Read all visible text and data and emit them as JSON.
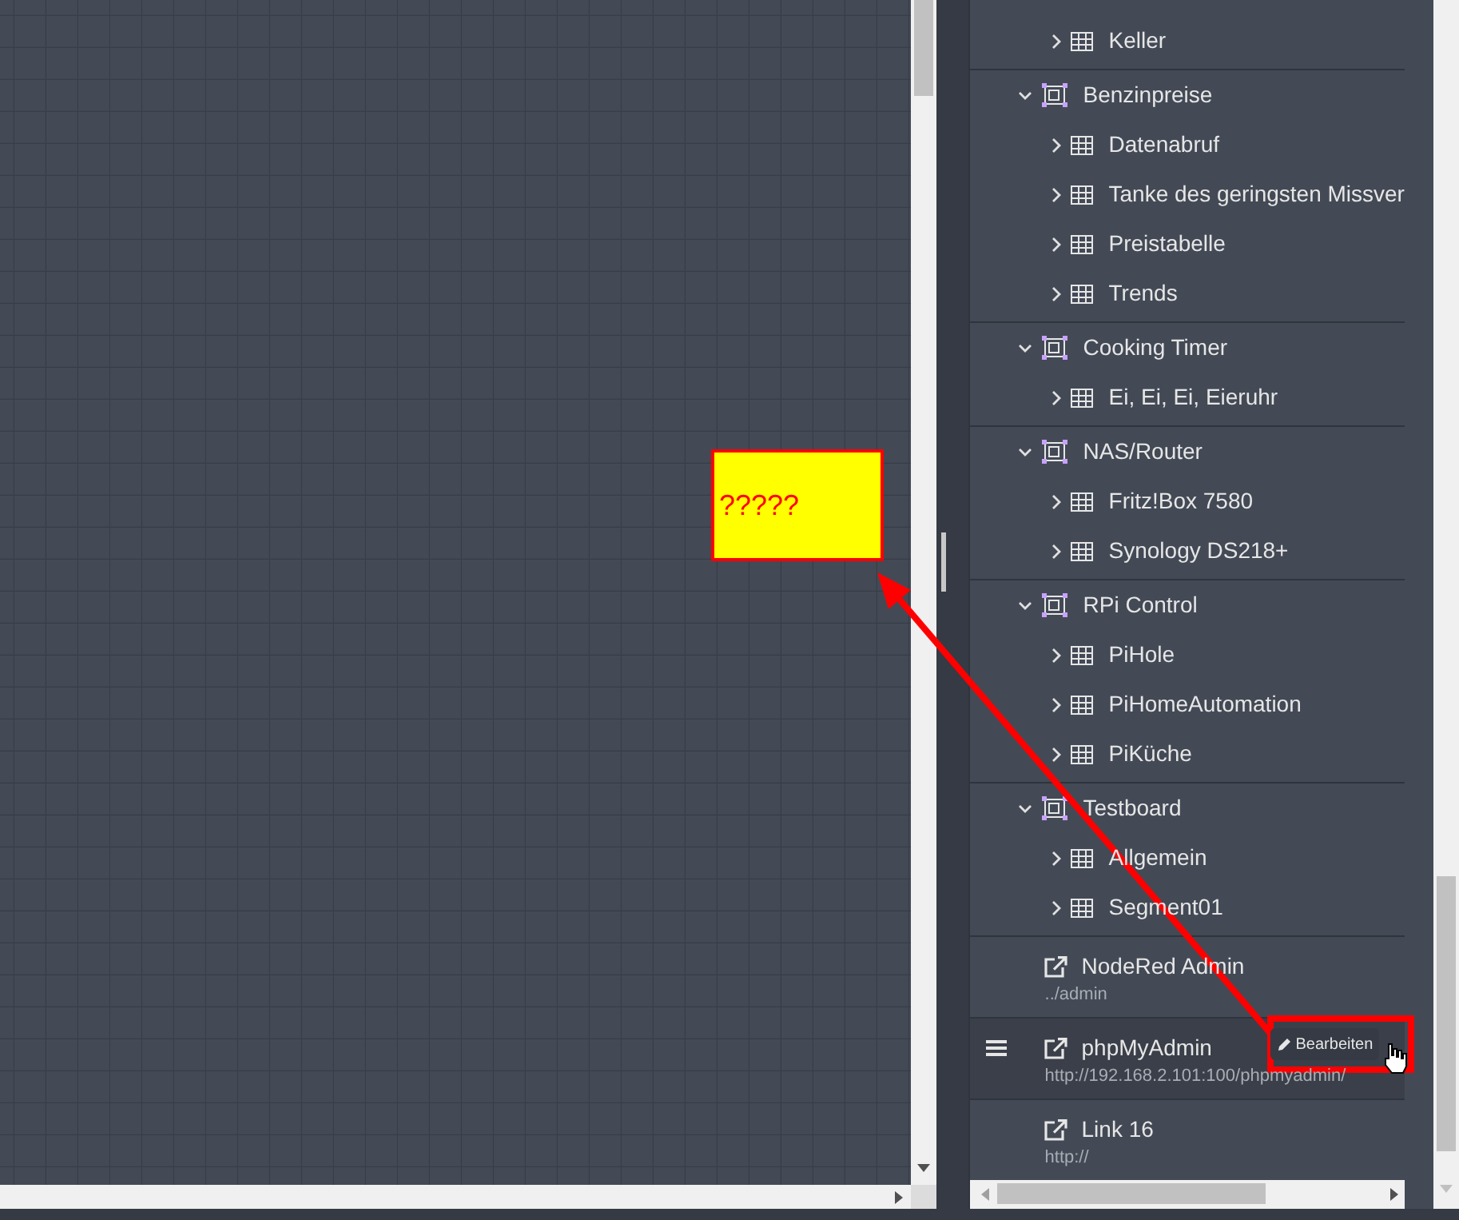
{
  "tree": [
    {
      "children": [
        {
          "label": "Keller",
          "expanded": false
        }
      ]
    },
    {
      "label": "Benzinpreise",
      "expanded": true,
      "children": [
        {
          "label": "Datenabruf",
          "expanded": false
        },
        {
          "label": "Tanke des geringsten Missver",
          "expanded": false
        },
        {
          "label": "Preistabelle",
          "expanded": false
        },
        {
          "label": "Trends",
          "expanded": false
        }
      ]
    },
    {
      "label": "Cooking Timer",
      "expanded": true,
      "children": [
        {
          "label": "Ei, Ei, Ei, Eieruhr",
          "expanded": false
        }
      ]
    },
    {
      "label": "NAS/Router",
      "expanded": true,
      "children": [
        {
          "label": "Fritz!Box 7580",
          "expanded": false
        },
        {
          "label": "Synology DS218+",
          "expanded": false
        }
      ]
    },
    {
      "label": "RPi Control",
      "expanded": true,
      "children": [
        {
          "label": "PiHole",
          "expanded": false
        },
        {
          "label": "PiHomeAutomation",
          "expanded": false
        },
        {
          "label": "PiKüche",
          "expanded": false
        }
      ]
    },
    {
      "label": "Testboard",
      "expanded": true,
      "children": [
        {
          "label": "Allgemein",
          "expanded": false
        },
        {
          "label": "Segment01",
          "expanded": false
        }
      ]
    }
  ],
  "links": [
    {
      "label": "NodeRed Admin",
      "url": "../admin",
      "hovered": false
    },
    {
      "label": "phpMyAdmin",
      "url": "http://192.168.2.101:100/phpmyadmin/",
      "hovered": true,
      "edit_button": "Bearbeiten"
    },
    {
      "label": "Link 16",
      "url": "http://",
      "hovered": false
    }
  ],
  "annotation": {
    "note": "?????"
  }
}
